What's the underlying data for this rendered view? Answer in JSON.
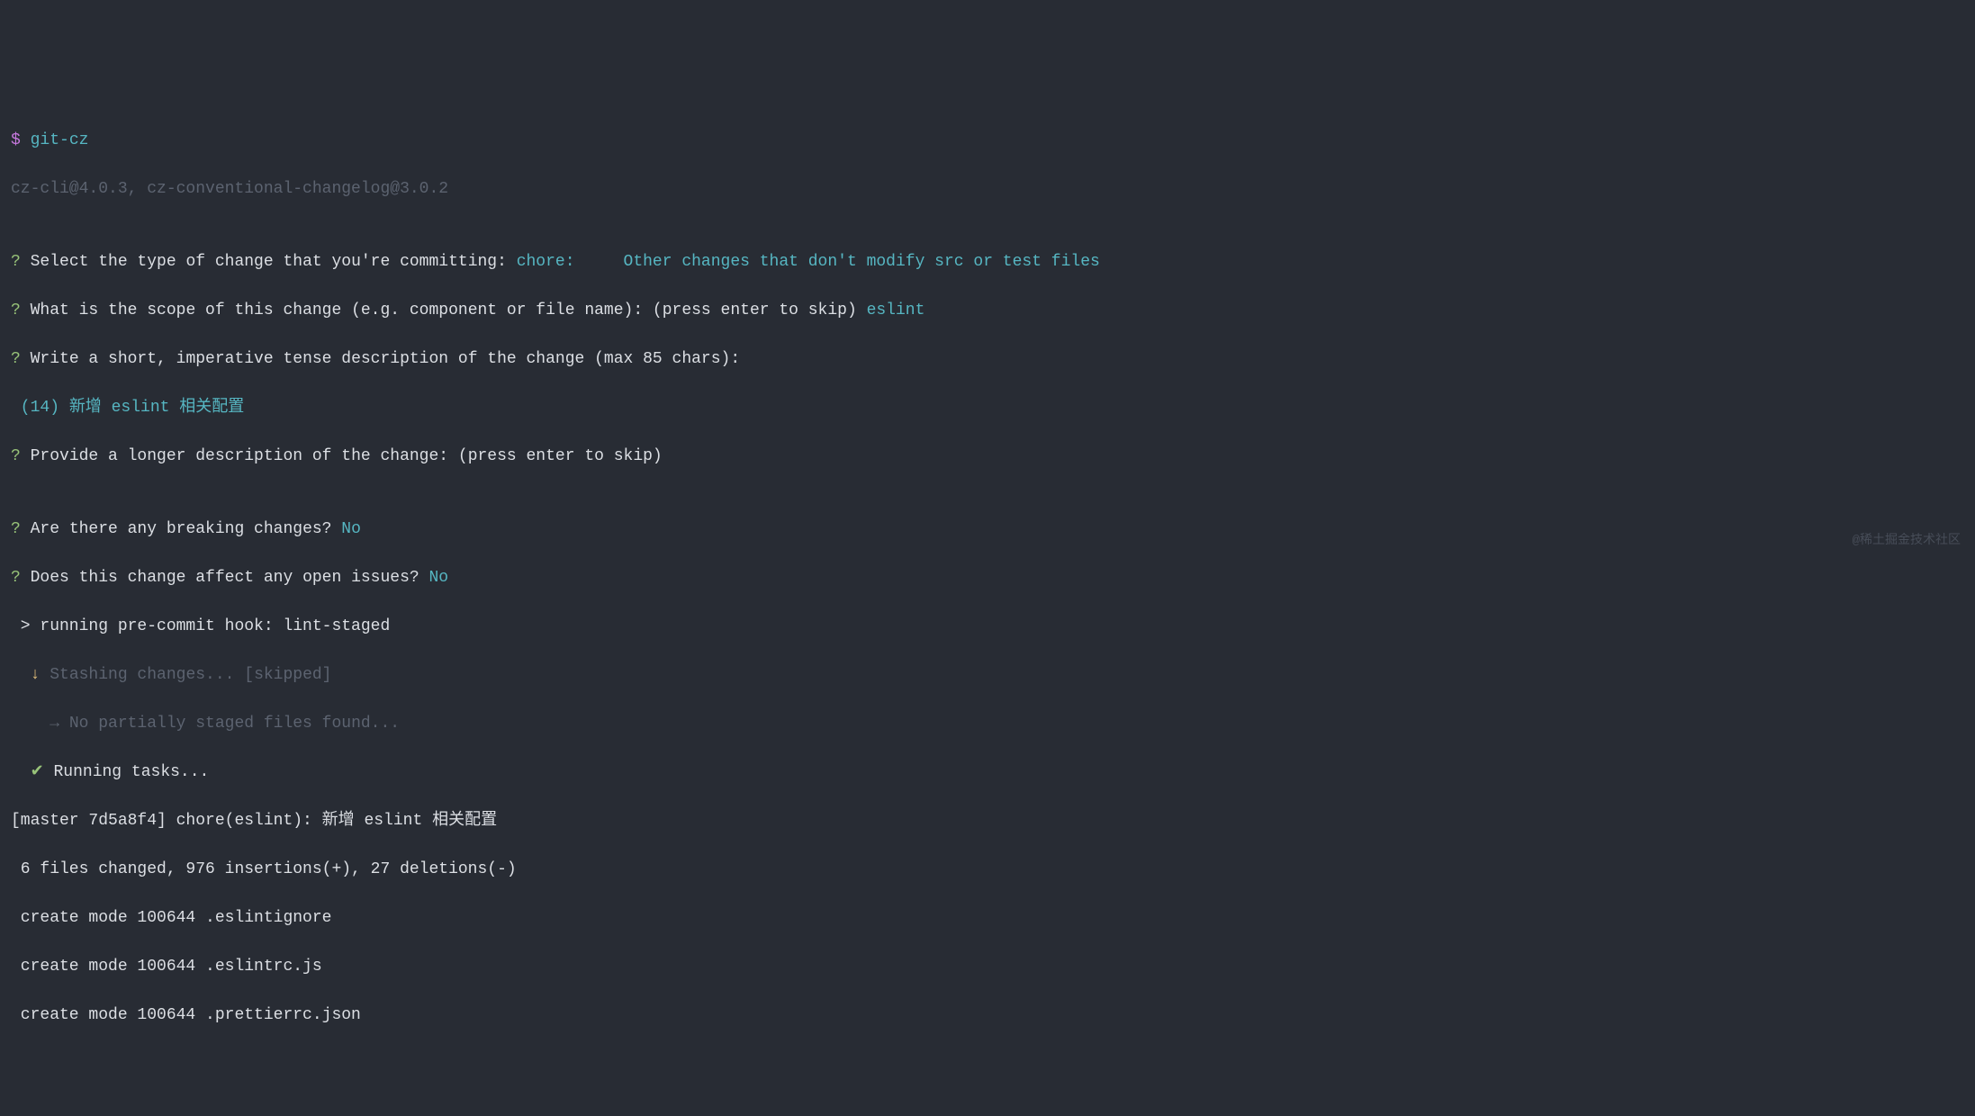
{
  "prompt": {
    "dollar": "$",
    "command": " git-cz"
  },
  "version_line": "cz-cli@4.0.3, cz-conventional-changelog@3.0.2",
  "blank": "",
  "questions": {
    "q1": {
      "mark": "?",
      "text": " Select the type of change that you're committing: ",
      "answer": "chore:     Other changes that don't modify src or test files"
    },
    "q2": {
      "mark": "?",
      "text": " What is the scope of this change (e.g. component or file name): (press enter to skip) ",
      "answer": "eslint"
    },
    "q3": {
      "mark": "?",
      "text": " Write a short, imperative tense description of the change (max 85 chars):"
    },
    "q3_answer": {
      "count": " (14) ",
      "text1": "新增 ",
      "text2": "eslint",
      "text3": " 相关配置"
    },
    "q4": {
      "mark": "?",
      "text": " Provide a longer description of the change: (press enter to skip)"
    },
    "q5": {
      "mark": "?",
      "text": " Are there any breaking changes? ",
      "answer": "No"
    },
    "q6": {
      "mark": "?",
      "text": " Does this change affect any open issues? ",
      "answer": "No"
    }
  },
  "hook": {
    "running": " > running pre-commit hook: lint-staged",
    "stash_arrow": "  ↓ ",
    "stash_text": "Stashing changes... ",
    "stash_status": "[skipped]",
    "stash_detail_arrow": "    → ",
    "stash_detail": "No partially staged files found...",
    "tasks_check": "  ✔ ",
    "tasks_text": "Running tasks..."
  },
  "commit": {
    "summary": "[master 7d5a8f4] chore(eslint): 新增 eslint 相关配置",
    "stats": " 6 files changed, 976 insertions(+), 27 deletions(-)",
    "file1": " create mode 100644 .eslintignore",
    "file2": " create mode 100644 .eslintrc.js",
    "file3": " create mode 100644 .prettierrc.json"
  },
  "watermark": "@稀土掘金技术社区"
}
